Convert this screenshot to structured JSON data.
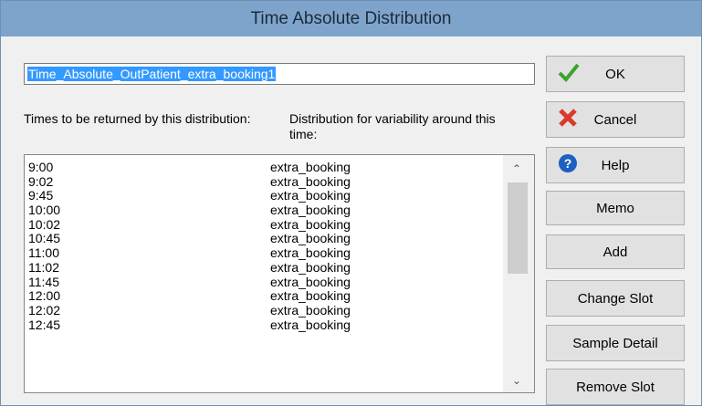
{
  "window": {
    "title": "Time Absolute Distribution"
  },
  "name_field": {
    "value": "Time_Absolute_OutPatient_extra_booking1"
  },
  "headers": {
    "times": "Times to be returned by this distribution:",
    "distribution": "Distribution for variability around this time:"
  },
  "list": {
    "rows": [
      {
        "time": "9:00",
        "dist": "extra_booking"
      },
      {
        "time": "9:02",
        "dist": "extra_booking"
      },
      {
        "time": "9:45",
        "dist": "extra_booking"
      },
      {
        "time": "10:00",
        "dist": "extra_booking"
      },
      {
        "time": "10:02",
        "dist": "extra_booking"
      },
      {
        "time": "10:45",
        "dist": "extra_booking"
      },
      {
        "time": "11:00",
        "dist": "extra_booking"
      },
      {
        "time": "11:02",
        "dist": "extra_booking"
      },
      {
        "time": "11:45",
        "dist": "extra_booking"
      },
      {
        "time": "12:00",
        "dist": "extra_booking"
      },
      {
        "time": "12:02",
        "dist": "extra_booking"
      },
      {
        "time": "12:45",
        "dist": "extra_booking"
      }
    ]
  },
  "buttons": {
    "ok": "OK",
    "cancel": "Cancel",
    "help": "Help",
    "memo": "Memo",
    "add": "Add",
    "change_slot": "Change Slot",
    "sample_detail": "Sample Detail",
    "remove_slot": "Remove Slot"
  },
  "icons": {
    "ok": "check-icon",
    "cancel": "cross-icon",
    "help": "question-icon"
  },
  "colors": {
    "title_bar": "#7fa4cc",
    "selection": "#3399ff",
    "ok_check": "#3aa52a",
    "cancel_x": "#d93a2b",
    "help_icon": "#1e5fc0"
  }
}
